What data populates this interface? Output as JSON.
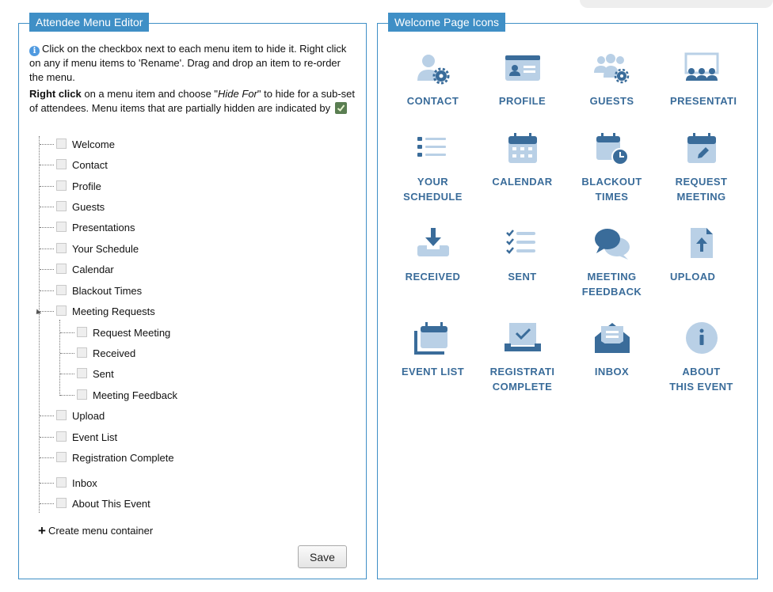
{
  "colors": {
    "accent": "#3f8fc6",
    "icon_dark": "#3a6c9a",
    "icon_light": "#b9d0e6"
  },
  "left_panel": {
    "title": "Attendee Menu Editor",
    "info_text": "Click on the checkbox next to each menu item to hide it. Right click on any if menu items to 'Rename'. Drag and drop an item to re-order the menu.",
    "right_click_strong": "Right click",
    "right_click_mid": " on a menu item and choose \"",
    "right_click_em": "Hide For",
    "right_click_rest": "\" to hide for a sub-set of attendees. Menu items that are partially hidden are indicated by",
    "menu_items": [
      "Welcome",
      "Contact",
      "Profile",
      "Guests",
      "Presentations",
      "Your Schedule",
      "Calendar",
      "Blackout Times",
      "Meeting Requests",
      "Request Meeting",
      "Received",
      "Sent",
      "Meeting Feedback",
      "Upload",
      "Event List",
      "Registration Complete",
      "Inbox",
      "About This Event"
    ],
    "create_label": "Create menu container",
    "save_label": "Save"
  },
  "right_panel": {
    "title": "Welcome Page Icons",
    "icons": [
      {
        "label": "CONTACT",
        "icon": "user-gear-icon"
      },
      {
        "label": "PROFILE",
        "icon": "id-card-icon"
      },
      {
        "label": "GUESTS",
        "icon": "users-gear-icon"
      },
      {
        "label": "PRESENTATI",
        "icon": "presentation-icon"
      },
      {
        "label": "YOUR\nSCHEDULE",
        "icon": "list-icon"
      },
      {
        "label": "CALENDAR",
        "icon": "calendar-icon"
      },
      {
        "label": "BLACKOUT\nTIMES",
        "icon": "calendar-clock-icon"
      },
      {
        "label": "REQUEST\nMEETING",
        "icon": "calendar-pen-icon"
      },
      {
        "label": "RECEIVED",
        "icon": "download-tray-icon"
      },
      {
        "label": "SENT",
        "icon": "checklist-icon"
      },
      {
        "label": "MEETING\nFEEDBACK",
        "icon": "chat-bubbles-icon"
      },
      {
        "label": "UPLOAD",
        "icon": "file-upload-icon"
      },
      {
        "label": "EVENT LIST",
        "icon": "event-list-icon"
      },
      {
        "label": "REGISTRATI\nCOMPLETE",
        "icon": "laptop-check-icon"
      },
      {
        "label": "INBOX",
        "icon": "envelope-open-icon"
      },
      {
        "label": "ABOUT\nTHIS EVENT",
        "icon": "info-circle-icon"
      }
    ]
  }
}
